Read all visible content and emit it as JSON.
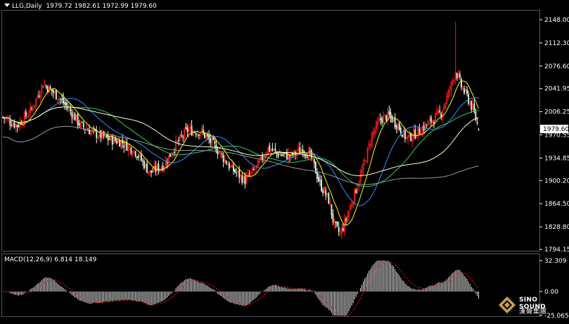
{
  "header": {
    "symbol": "LLG,Daily",
    "ohlc": "1979.72 1982.61 1972.99 1979.60"
  },
  "macd_header": {
    "label": "MACD(12,26,9)",
    "values": "6.814 18.149"
  },
  "price_axis": {
    "ticks": [
      "2148.00",
      "2112.30",
      "2076.60",
      "2041.95",
      "2006.25",
      "1970.55",
      "1934.85",
      "1900.20",
      "1864.50",
      "1828.80",
      "1794.15"
    ],
    "current_price": "1979.60"
  },
  "macd_axis": {
    "ticks": [
      "32.309",
      "0.00",
      "-25.065"
    ]
  },
  "watermark": {
    "brand_en": "SINO SOUND",
    "brand_cn": "漢聲集團"
  },
  "colors": {
    "background": "#000000",
    "bull_candle": "#ff1a1a",
    "bear_candle": "#e8ffe8",
    "ma_fast": "#ffff00",
    "ma_blue": "#3c8cff",
    "ma_green": "#33cc66",
    "ma_light": "#ffffcc",
    "ma_gray": "#999999",
    "macd_signal": "#ff2020",
    "axis_text": "#ffffff"
  },
  "chart_data": {
    "type": "candlestick",
    "symbol": "LLG",
    "timeframe": "Daily",
    "ylim": [
      1794.15,
      2148.0
    ],
    "last_ohlc": [
      1979.72,
      1982.61,
      1972.99,
      1979.6
    ],
    "trend_points": [
      [
        0,
        1998
      ],
      [
        10,
        1985
      ],
      [
        20,
        2010
      ],
      [
        28,
        2050
      ],
      [
        38,
        2030
      ],
      [
        46,
        2010
      ],
      [
        54,
        1985
      ],
      [
        62,
        1975
      ],
      [
        72,
        1965
      ],
      [
        82,
        1960
      ],
      [
        92,
        1945
      ],
      [
        102,
        1912
      ],
      [
        112,
        1925
      ],
      [
        120,
        1955
      ],
      [
        128,
        1978
      ],
      [
        138,
        1975
      ],
      [
        148,
        1950
      ],
      [
        158,
        1920
      ],
      [
        168,
        1900
      ],
      [
        176,
        1920
      ],
      [
        184,
        1950
      ],
      [
        192,
        1940
      ],
      [
        200,
        1938
      ],
      [
        208,
        1950
      ],
      [
        214,
        1935
      ],
      [
        220,
        1895
      ],
      [
        226,
        1870
      ],
      [
        230,
        1830
      ],
      [
        234,
        1818
      ],
      [
        238,
        1840
      ],
      [
        244,
        1880
      ],
      [
        250,
        1920
      ],
      [
        256,
        1970
      ],
      [
        262,
        1995
      ],
      [
        268,
        2000
      ],
      [
        274,
        1985
      ],
      [
        280,
        1965
      ],
      [
        288,
        1975
      ],
      [
        296,
        1990
      ],
      [
        304,
        2005
      ],
      [
        310,
        2040
      ],
      [
        314,
        2070
      ],
      [
        318,
        2045
      ],
      [
        322,
        2030
      ],
      [
        326,
        2010
      ],
      [
        330,
        1980
      ]
    ],
    "macd": {
      "fast": 12,
      "slow": 26,
      "signal": 9,
      "value": 6.814,
      "signal_value": 18.149,
      "ylim": [
        -25.065,
        32.309
      ]
    }
  }
}
